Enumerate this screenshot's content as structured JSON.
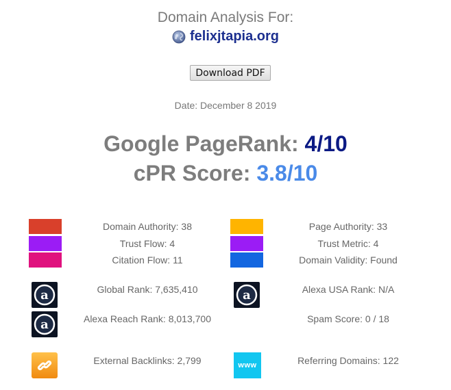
{
  "header": {
    "title": "Domain Analysis For:",
    "domain": "felixjtapia.org",
    "download_label": "Download PDF",
    "date": "Date: December 8 2019"
  },
  "ranks": {
    "pagerank_label": "Google PageRank:",
    "pagerank_value": "4/10",
    "cpr_label": "cPR Score:",
    "cpr_value": "3.8/10"
  },
  "metrics": {
    "domain_authority": "Domain Authority: 38",
    "trust_flow": "Trust Flow: 4",
    "citation_flow": "Citation Flow: 11",
    "page_authority": "Page Authority: 33",
    "trust_metric": "Trust Metric: 4",
    "domain_validity": "Domain Validity: Found",
    "global_rank": "Global Rank: 7,635,410",
    "alexa_usa_rank": "Alexa USA Rank: N/A",
    "alexa_reach_rank": "Alexa Reach Rank: 8,013,700",
    "spam_score": "Spam Score: 0 / 18",
    "external_backlinks": "External Backlinks: 2,799",
    "referring_domains": "Referring Domains: 122"
  },
  "icons": {
    "www_text": "www"
  },
  "colors": {
    "domain_authority": "#d9402b",
    "trust_flow": "#9b1cf5",
    "citation_flow": "#e0127e",
    "page_authority": "#ffb400",
    "trust_metric": "#9b1cf5",
    "domain_validity": "#1366e0",
    "pagerank_value": "#0b1a84",
    "cpr_value": "#4a8ae8",
    "domain_link": "#1c2f8f"
  }
}
